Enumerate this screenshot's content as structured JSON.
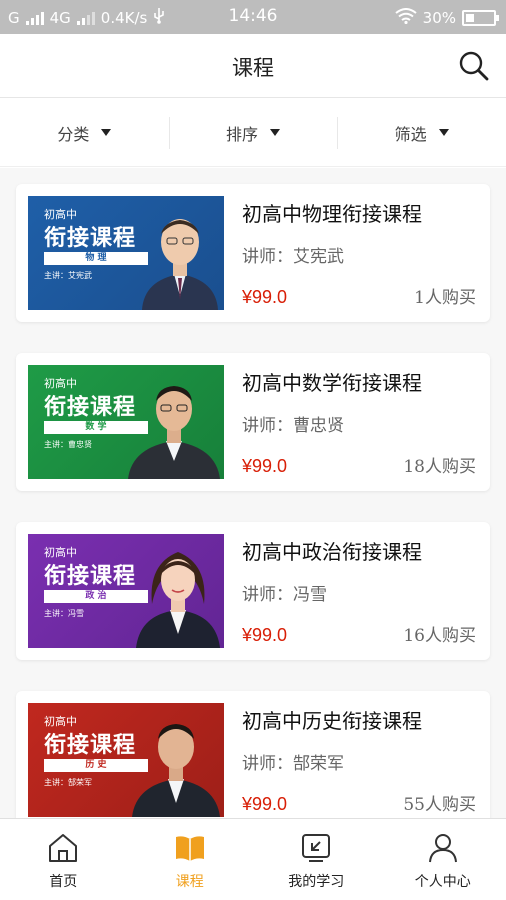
{
  "status_bar": {
    "carrier_left": "G",
    "network": "4G",
    "speed": "0.4K/s",
    "time": "14:46",
    "battery": "30%"
  },
  "header": {
    "title": "课程"
  },
  "filters": [
    {
      "label": "分类"
    },
    {
      "label": "排序"
    },
    {
      "label": "筛选"
    }
  ],
  "courses": [
    {
      "title": "初高中物理衔接课程",
      "lecturer": "讲师：艾宪武",
      "price": "¥99.0",
      "buyers": "1人购买",
      "thumb": {
        "pre": "初高中",
        "big": "衔接课程",
        "subject": "物 理",
        "lecturer": "主讲：艾宪武",
        "bg": "#1f5fa8",
        "accent": "#1a4f8f",
        "subject_color": "#1f5fa8"
      }
    },
    {
      "title": "初高中数学衔接课程",
      "lecturer": "讲师：曹忠贤",
      "price": "¥99.0",
      "buyers": "18人购买",
      "thumb": {
        "pre": "初高中",
        "big": "衔接课程",
        "subject": "数 学",
        "lecturer": "主讲：曹忠贤",
        "bg": "#1f9b47",
        "accent": "#17803a",
        "subject_color": "#1f9b47"
      }
    },
    {
      "title": "初高中政治衔接课程",
      "lecturer": "讲师：冯雪",
      "price": "¥99.0",
      "buyers": "16人购买",
      "thumb": {
        "pre": "初高中",
        "big": "衔接课程",
        "subject": "政 治",
        "lecturer": "主讲：冯雪",
        "bg": "#7a2fb0",
        "accent": "#622594",
        "subject_color": "#7a2fb0"
      }
    },
    {
      "title": "初高中历史衔接课程",
      "lecturer": "讲师：郜荣军",
      "price": "¥99.0",
      "buyers": "55人购买",
      "thumb": {
        "pre": "初高中",
        "big": "衔接课程",
        "subject": "历 史",
        "lecturer": "主讲：郜荣军",
        "bg": "#c0281f",
        "accent": "#9e1f18",
        "subject_color": "#c0281f"
      }
    }
  ],
  "bottom_nav": [
    {
      "label": "首页",
      "icon": "home-icon",
      "active": false
    },
    {
      "label": "课程",
      "icon": "book-icon",
      "active": true
    },
    {
      "label": "我的学习",
      "icon": "monitor-icon",
      "active": false
    },
    {
      "label": "个人中心",
      "icon": "person-icon",
      "active": false
    }
  ],
  "colors": {
    "accent": "#f0a01e",
    "price": "#d81e06"
  }
}
